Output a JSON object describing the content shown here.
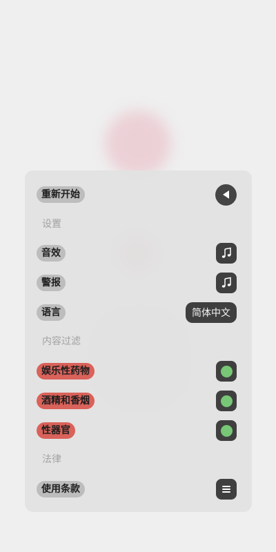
{
  "menu": {
    "restart": {
      "label": "重新开始",
      "icon": "play-back-icon"
    },
    "sections": {
      "settings": "设置",
      "content_filter": "内容过滤",
      "legal": "法律"
    },
    "settings": {
      "sound": {
        "label": "音效",
        "icon": "music-note-icon"
      },
      "alert": {
        "label": "警报",
        "icon": "music-note-icon"
      },
      "language": {
        "label": "语言",
        "value": "简体中文"
      }
    },
    "filters": [
      {
        "label": "娱乐性药物",
        "enabled": true
      },
      {
        "label": "酒精和香烟",
        "enabled": true
      },
      {
        "label": "性器官",
        "enabled": true
      }
    ],
    "legal": {
      "terms": {
        "label": "使用条款",
        "icon": "document-lines-icon"
      }
    }
  },
  "colors": {
    "panel_bg": "#e2e2e2",
    "pill_gray": "#bdbdbd",
    "pill_red": "#d9625a",
    "button_dark": "#3f3f3f",
    "toggle_on": "#77c776",
    "section_text": "#a2a2a2"
  }
}
